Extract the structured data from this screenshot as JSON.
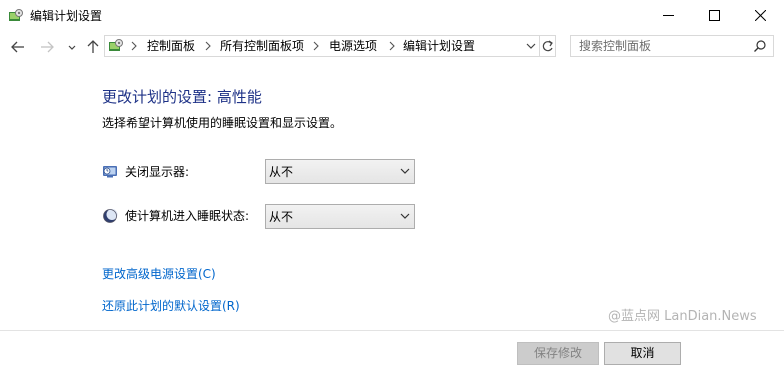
{
  "window": {
    "title": "编辑计划设置",
    "controls": [
      "minimize-icon",
      "maximize-icon",
      "close-icon"
    ]
  },
  "navigation": {
    "breadcrumbs": [
      "控制面板",
      "所有控制面板项",
      "电源选项",
      "编辑计划设置"
    ],
    "search_placeholder": "搜索控制面板"
  },
  "main": {
    "heading": "更改计划的设置: 高性能",
    "subtitle": "选择希望计算机使用的睡眠设置和显示设置。",
    "settings": [
      {
        "label": "关闭显示器:",
        "value": "从不",
        "icon": "display-icon"
      },
      {
        "label": "使计算机进入睡眠状态:",
        "value": "从不",
        "icon": "sleep-icon"
      }
    ],
    "links": [
      "更改高级电源设置(C)",
      "还原此计划的默认设置(R)"
    ]
  },
  "footer": {
    "save_label": "保存修改",
    "cancel_label": "取消"
  },
  "watermark": "@蓝点网 LanDian.News",
  "colors": {
    "heading": "#1e3287",
    "link": "#0066cc",
    "disabled_button": "#cccccc"
  }
}
